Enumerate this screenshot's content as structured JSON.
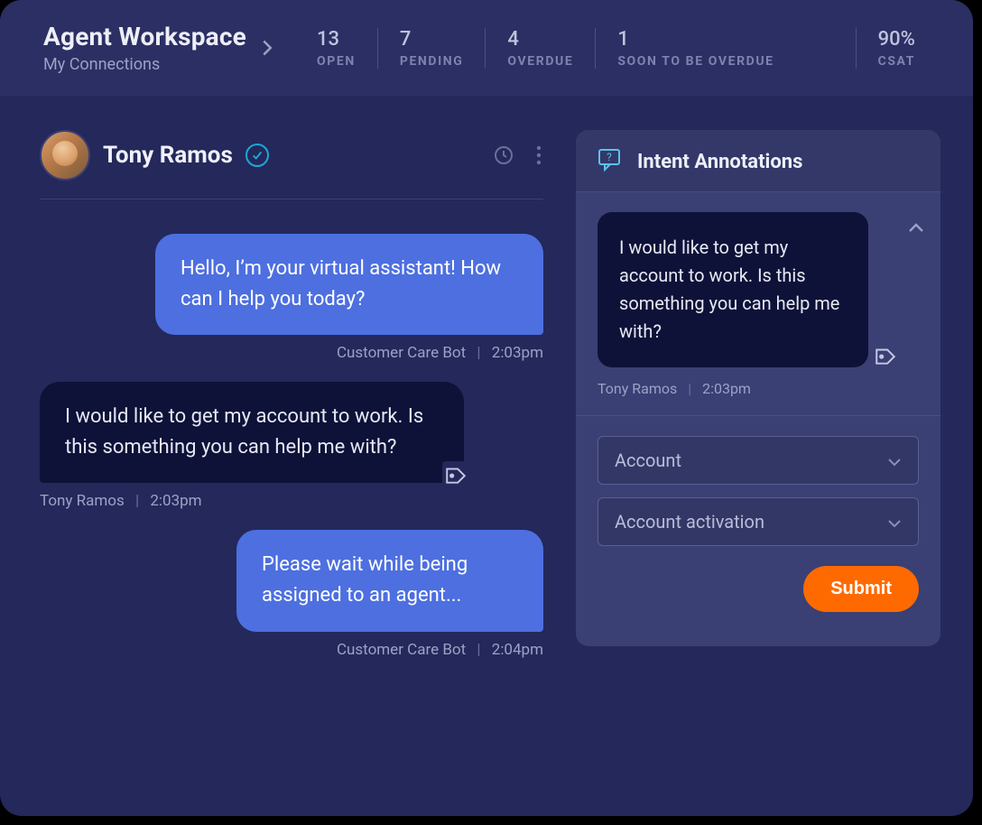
{
  "header": {
    "title": "Agent Workspace",
    "breadcrumb": "My Connections",
    "stats": {
      "open": {
        "value": "13",
        "label": "OPEN"
      },
      "pending": {
        "value": "7",
        "label": "PENDING"
      },
      "overdue": {
        "value": "4",
        "label": "OVERDUE"
      },
      "soon": {
        "value": "1",
        "label": "SOON TO BE OVERDUE"
      },
      "csat": {
        "value": "90%",
        "label": "CSAT"
      }
    }
  },
  "chat": {
    "customer_name": "Tony Ramos",
    "messages": [
      {
        "side": "bot",
        "text": "Hello, I’m your virtual assistant! How can I help you today?",
        "author": "Customer Care Bot",
        "time": "2:03pm"
      },
      {
        "side": "user",
        "text": "I would like to get my account to work. Is this something you can help me with?",
        "author": "Tony Ramos",
        "time": "2:03pm"
      },
      {
        "side": "bot",
        "text": "Please wait while being assigned to an agent...",
        "author": "Customer Care Bot",
        "time": "2:04pm"
      }
    ]
  },
  "panel": {
    "title": "Intent Annotations",
    "quote": {
      "text": "I would like to get my account to work. Is this something you can help me with?",
      "author": "Tony Ramos",
      "time": "2:03pm"
    },
    "select_topic": "Account",
    "select_intent": "Account activation",
    "submit_label": "Submit"
  }
}
